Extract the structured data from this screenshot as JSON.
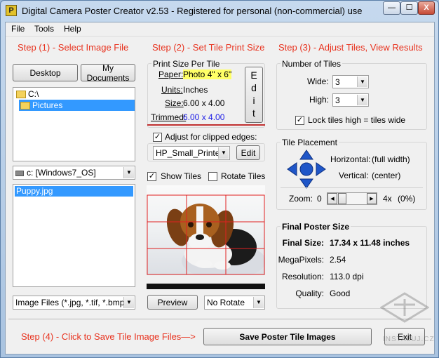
{
  "window": {
    "title": "Digital Camera Poster Creator v2.53 - Registered for personal (non-commercial) use",
    "app_icon": "P",
    "controls": {
      "minimize": "—",
      "maximize": "☐",
      "close": "X"
    }
  },
  "menu": [
    "File",
    "Tools",
    "Help"
  ],
  "step1": {
    "heading": "Step (1) - Select Image File",
    "desktop_button": "Desktop",
    "mydocs_button": "My Documents",
    "folders": [
      "C:\\",
      "Pictures"
    ],
    "drive": "c: [Windows7_OS]",
    "files": [
      "Puppy.jpg"
    ],
    "filter": "Image Files (*.jpg, *.tif, *.bmp)"
  },
  "step2": {
    "heading": "Step (2) - Set Tile Print Size",
    "group_label": "Print Size Per Tile",
    "paper_label": "Paper:",
    "paper_value": "Photo 4\" x 6\"",
    "units_label": "Units:",
    "units_value": "Inches",
    "size_label": "Size:",
    "size_value": "6.00 x 4.00",
    "trimmed_label": "Trimmed:",
    "trimmed_value": "6.00 x 4.00",
    "edit_button": "Edit",
    "adjust_label": "Adjust for clipped edges:",
    "printer": "HP_Small_Printer",
    "printer_edit": "Edit",
    "show_tiles": "Show Tiles",
    "rotate_tiles": "Rotate Tiles",
    "preview_button": "Preview",
    "rotate_option": "No Rotate"
  },
  "step3": {
    "heading": "Step (3) - Adjust Tiles, View Results",
    "tiles_group": "Number of Tiles",
    "wide_label": "Wide:",
    "wide_value": "3",
    "high_label": "High:",
    "high_value": "3",
    "lock_label": "Lock tiles high = tiles wide",
    "placement_group": "Tile Placement",
    "horizontal_label": "Horizontal:",
    "horizontal_value": "(full width)",
    "vertical_label": "Vertical:",
    "vertical_value": "(center)",
    "zoom_label": "Zoom:",
    "zoom_min": "0",
    "zoom_max": "4x",
    "zoom_pct": "(0%)",
    "zoom_level": 0,
    "final_group": "Final Poster Size",
    "final_size_label": "Final Size:",
    "final_size_value": "17.34 x 11.48 inches",
    "megapixels_label": "MegaPixels:",
    "megapixels_value": "2.54",
    "resolution_label": "Resolution:",
    "resolution_value": "113.0 dpi",
    "quality_label": "Quality:",
    "quality_value": "Good"
  },
  "step4": {
    "heading": "Step (4) - Click to Save Tile Image Files—>",
    "save_button": "Save Poster Tile Images",
    "exit_button": "Exit"
  },
  "watermark": "INSTALUJ.CZ",
  "colors": {
    "accent": "#e8321e",
    "selection": "#3399ff",
    "highlight": "#ffff66",
    "grid": "#e02020",
    "arrows": "#1f56c8"
  }
}
